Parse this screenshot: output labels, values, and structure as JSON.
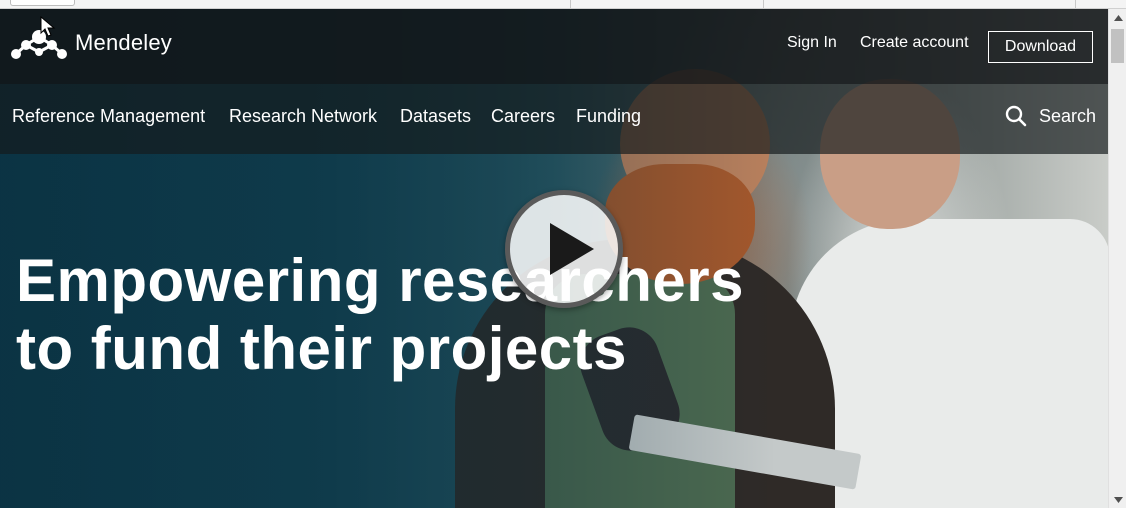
{
  "header": {
    "brand": "Mendeley",
    "sign_in": "Sign In",
    "create_account": "Create account",
    "download": "Download"
  },
  "nav": {
    "items": [
      {
        "label": "Reference Management"
      },
      {
        "label": "Research Network"
      },
      {
        "label": "Datasets"
      },
      {
        "label": "Careers"
      },
      {
        "label": "Funding"
      }
    ],
    "search_label": "Search"
  },
  "hero": {
    "title_line1": "Empowering researchers",
    "title_line2": "to fund their projects"
  },
  "icons": {
    "logo": "mendeley-logo-icon",
    "search": "search-icon",
    "play": "play-icon",
    "scroll_up": "chevron-up-icon",
    "scroll_down": "chevron-down-icon"
  },
  "colors": {
    "topbar": "#121618",
    "accent_text": "#ffffff"
  }
}
